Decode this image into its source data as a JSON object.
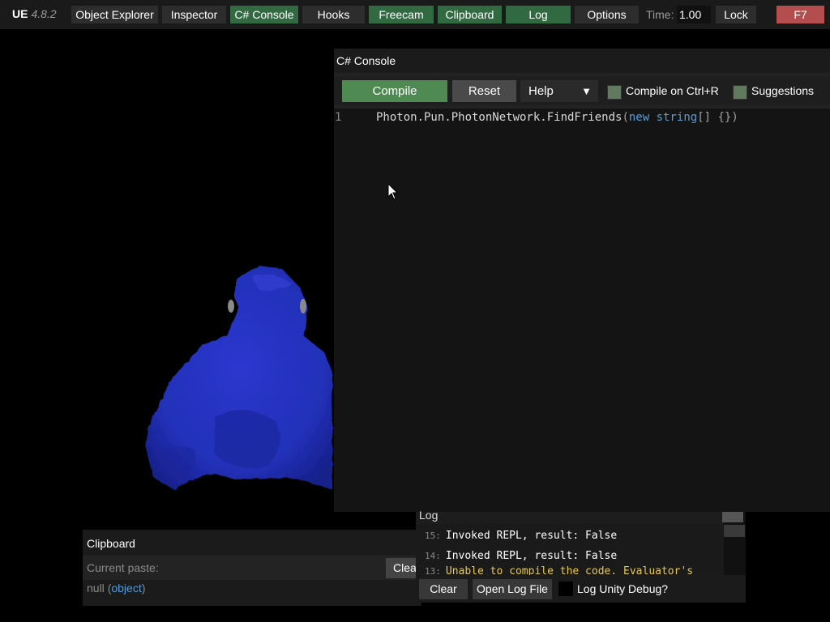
{
  "topbar": {
    "logo": "UE",
    "version": "4.8.2",
    "buttons": [
      {
        "label": "Object Explorer",
        "active": false
      },
      {
        "label": "Inspector",
        "active": false
      },
      {
        "label": "C# Console",
        "active": true
      },
      {
        "label": "Hooks",
        "active": false
      },
      {
        "label": "Freecam",
        "active": true
      },
      {
        "label": "Clipboard",
        "active": true
      },
      {
        "label": "Log",
        "active": true
      },
      {
        "label": "Options",
        "active": false
      }
    ],
    "time_label": "Time:",
    "time_value": "1.00",
    "lock_label": "Lock",
    "hotkey_label": "F7"
  },
  "console": {
    "title": "C# Console",
    "compile_label": "Compile",
    "reset_label": "Reset",
    "help_label": "Help",
    "help_arrow": "▼",
    "compile_on_ctrl_label": "Compile on Ctrl+R",
    "suggestions_label": "Suggestions",
    "line_number": "1",
    "code": {
      "part1": "Photon.Pun.PhotonNetwork.FindFriends",
      "paren_open": "(",
      "kw_new": "new",
      "kw_string": "string",
      "rest": "[] {})"
    }
  },
  "clipboard": {
    "title": "Clipboard",
    "current_paste_label": "Current paste:",
    "clear_label": "Clear",
    "value_null": "null",
    "value_paren_open": "(",
    "value_type": "object",
    "value_paren_close": ")"
  },
  "log": {
    "title": "Log",
    "entries": [
      {
        "index": "15:",
        "text": "Invoked REPL, result: False",
        "type": "info"
      },
      {
        "index": "14:",
        "text": "Invoked REPL, result: False",
        "type": "info"
      },
      {
        "index": "13:",
        "text": "Unable to compile the code. Evaluator's",
        "type": "error"
      }
    ],
    "clear_label": "Clear",
    "open_log_file_label": "Open Log File",
    "unity_debug_label": "Log Unity Debug?"
  },
  "colors": {
    "active_button": "#316a40",
    "hotkey_button": "#b44e4e",
    "compile_button": "#4f8a52",
    "keyword": "#569cd6",
    "error_text": "#e6c84a",
    "gorilla": "#2a35c8"
  }
}
